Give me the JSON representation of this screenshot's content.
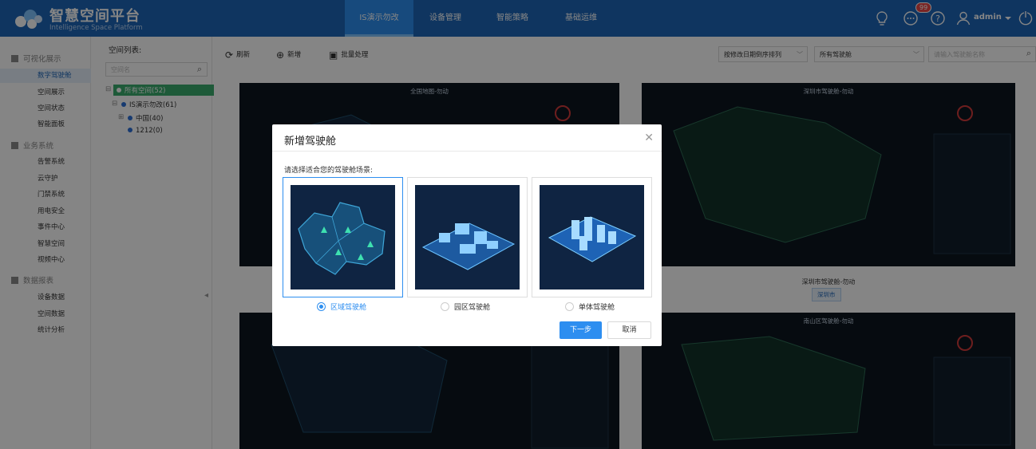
{
  "app": {
    "title": "智慧空间平台",
    "subtitle": "Intelligence Space Platform"
  },
  "nav": [
    {
      "label": "IS演示勿改",
      "active": true
    },
    {
      "label": "设备管理"
    },
    {
      "label": "智能策略"
    },
    {
      "label": "基础运维"
    }
  ],
  "topbar": {
    "notification_count": "99",
    "user": "admin",
    "icons": [
      "bulb-icon",
      "chat-icon",
      "help-icon",
      "user-icon",
      "chevron-down-icon",
      "logout-icon"
    ]
  },
  "sidebar": {
    "sections": [
      {
        "label": "可视化展示",
        "items": [
          "数字驾驶舱",
          "空间展示",
          "空间状态",
          "智能面板"
        ]
      },
      {
        "label": "业务系统",
        "items": [
          "告警系统",
          "云守护",
          "门禁系统",
          "用电安全",
          "事件中心",
          "智慧空间",
          "视频中心"
        ]
      },
      {
        "label": "数据报表",
        "items": [
          "设备数据",
          "空间数据",
          "统计分析"
        ]
      }
    ],
    "active_item": "数字驾驶舱"
  },
  "tree": {
    "label": "空间列表:",
    "search_placeholder": "空间名",
    "nodes": [
      "所有空间(52)",
      "IS演示勿改(61)",
      "中国(40)",
      "1212(0)"
    ]
  },
  "toolbar": {
    "refresh": "刷新",
    "add": "新增",
    "batch": "批量处理",
    "sort": "按修改日期倒序排列",
    "filter": "所有驾驶舱",
    "search_placeholder": "请输入驾驶舱名称"
  },
  "cards": [
    {
      "title": "全国地图-勿动"
    },
    {
      "title": "深圳市驾驶舱-勿动",
      "caption": "深圳市驾驶舱-勿动",
      "tag": "深圳市"
    },
    {
      "title": ""
    },
    {
      "title": "南山区驾驶舱-勿动"
    }
  ],
  "modal": {
    "title": "新增驾驶舱",
    "prompt": "请选择适合您的驾驶舱场景:",
    "options": [
      "区域驾驶舱",
      "园区驾驶舱",
      "单体驾驶舱"
    ],
    "selected": "区域驾驶舱",
    "next": "下一步",
    "cancel": "取消"
  },
  "colors": {
    "primary": "#2d8ef0",
    "topbar": "#1e66b8",
    "tree_selected": "#3aad6e",
    "badge": "#e84545"
  }
}
